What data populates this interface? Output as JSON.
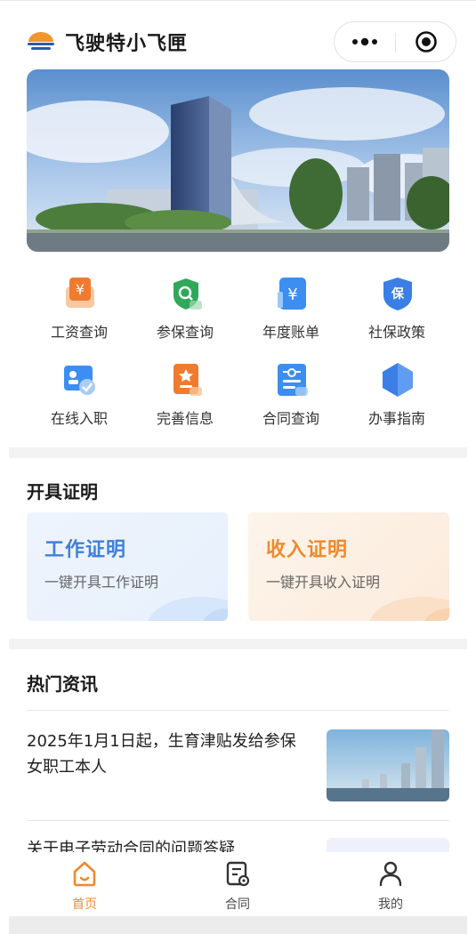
{
  "app": {
    "title": "飞驶特小飞匣"
  },
  "capsule": {
    "more_icon": "more-dots-icon",
    "close_icon": "target-circle-icon"
  },
  "services": [
    {
      "label": "工资查询",
      "icon": "salary-icon"
    },
    {
      "label": "参保查询",
      "icon": "insurance-search-icon"
    },
    {
      "label": "年度账单",
      "icon": "annual-bill-icon"
    },
    {
      "label": "社保政策",
      "icon": "social-security-policy-icon"
    },
    {
      "label": "在线入职",
      "icon": "onboarding-icon"
    },
    {
      "label": "完善信息",
      "icon": "profile-info-icon"
    },
    {
      "label": "合同查询",
      "icon": "contract-search-icon"
    },
    {
      "label": "办事指南",
      "icon": "guide-icon"
    }
  ],
  "certificates": {
    "section_title": "开具证明",
    "work": {
      "title": "工作证明",
      "subtitle": "一键开具工作证明"
    },
    "income": {
      "title": "收入证明",
      "subtitle": "一键开具收入证明"
    }
  },
  "news": {
    "section_title": "热门资讯",
    "items": [
      {
        "title": "2025年1月1日起，生育津贴发给参保女职工本人"
      },
      {
        "title": "关于电子劳动合同的问题答疑"
      }
    ]
  },
  "tabbar": [
    {
      "label": "首页",
      "icon": "home-icon",
      "active": true
    },
    {
      "label": "合同",
      "icon": "contract-icon",
      "active": false
    },
    {
      "label": "我的",
      "icon": "user-icon",
      "active": false
    }
  ],
  "colors": {
    "accent": "#ef8a2d",
    "blue": "#3f7fdc"
  }
}
